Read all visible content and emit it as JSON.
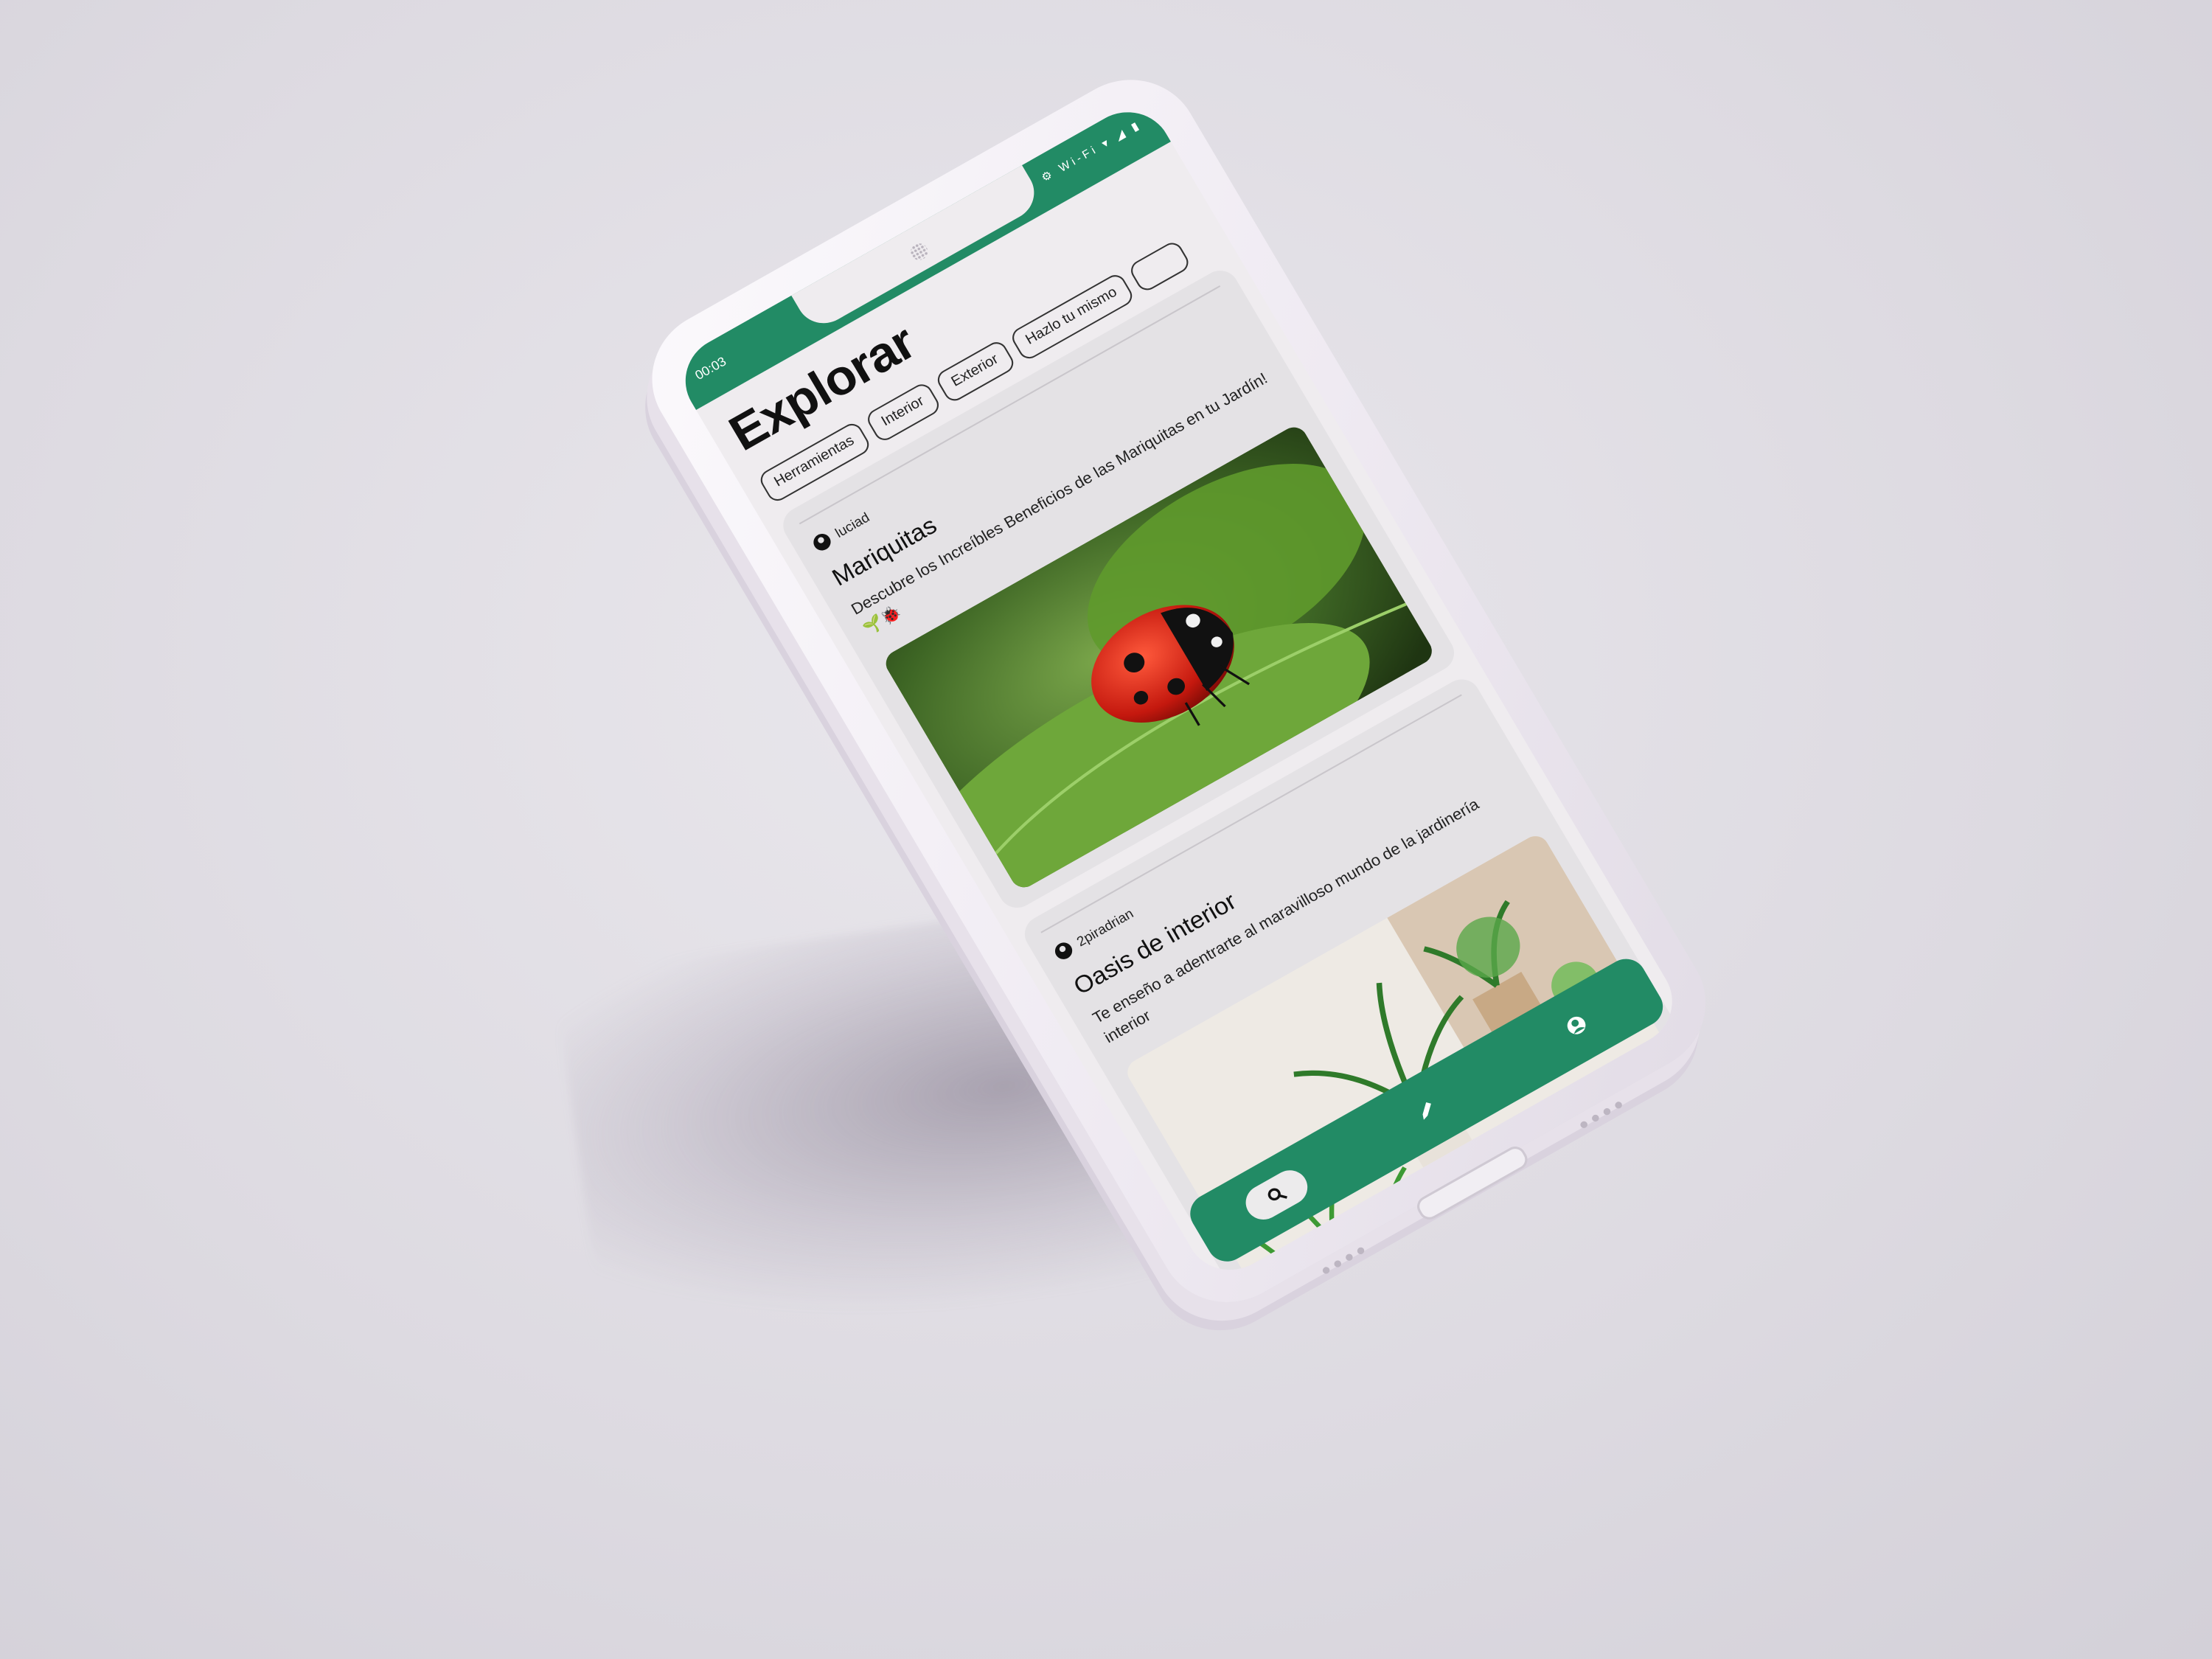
{
  "status_bar": {
    "time": "00:03",
    "icons": "⏰ ⚙ Wi-Fi ▾ ◢ ▮"
  },
  "header": {
    "title": "Explorar"
  },
  "categories": [
    "Herramientas",
    "Interior",
    "Exterior",
    "Hazlo tu mismo",
    ""
  ],
  "posts": [
    {
      "author": "luciad",
      "title": "Mariquitas",
      "description": "Descubre los Increíbles Beneficios de las Mariquitas en tu Jardín! 🌱🐞",
      "image": "ladybug-on-leaf"
    },
    {
      "author": "2piradrian",
      "title": "Oasis de interior",
      "description": "Te enseño a adentrarte al maravilloso mundo de la jardinería interior",
      "image": "indoor-plants"
    }
  ],
  "nav": {
    "search_icon": "search-icon",
    "create_icon": "pencil-icon",
    "profile_icon": "profile-icon"
  },
  "colors": {
    "accent": "#228b65",
    "background": "#efecef",
    "card": "#e4e2e5"
  }
}
